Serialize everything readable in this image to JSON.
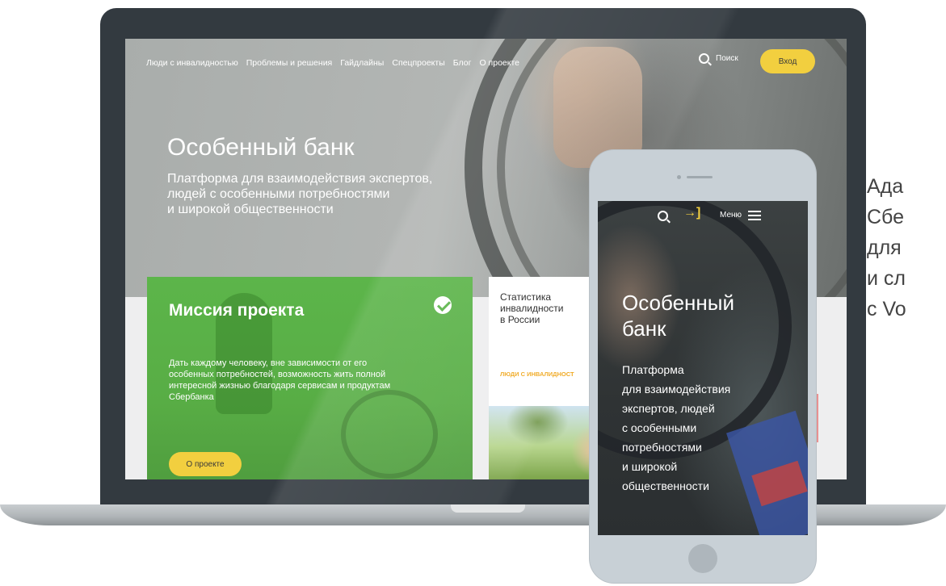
{
  "site": {
    "nav": [
      "Люди с инвалидностью",
      "Проблемы и решения",
      "Гайдлайны",
      "Спецпроекты",
      "Блог",
      "О проекте"
    ],
    "search_label": "Поиск",
    "login_label": "Вход",
    "hero_title": "Особенный банк",
    "hero_subtitle_lines": [
      "Платформа для взаимодействия экспертов,",
      "людей с особенными потребностями",
      "и широкой общественности"
    ],
    "mission": {
      "title": "Миссия проекта",
      "text": "Дать каждому человеку, вне зависимости от его особенных потребностей, возможность жить полной интересной жизнью благодаря сервисам и продуктам Сбербанка",
      "button": "О проекте"
    },
    "stats": {
      "title_lines": [
        "Статистика",
        "инвалидности",
        "в России"
      ],
      "tag": "ЛЮДИ С ИНВАЛИДНОСТ"
    }
  },
  "phone": {
    "menu_label": "Меню",
    "login_icon": "→]",
    "title_lines": [
      "Особенный",
      "банк"
    ],
    "subtitle_lines": [
      "Платформа",
      "для взаимодействия",
      "экспертов, людей",
      "с особенными",
      "потребностями",
      "и широкой",
      "общественности"
    ]
  },
  "caption_lines": [
    "Ада",
    "Сбе",
    "для",
    "и сл",
    "с Vo"
  ],
  "colors": {
    "accent_yellow": "#f2cf3f",
    "sber_green": "#5cb54a",
    "tag_orange": "#f0a81f"
  },
  "icons": [
    "search-icon",
    "login-icon",
    "menu-icon",
    "sber-logo-icon"
  ]
}
